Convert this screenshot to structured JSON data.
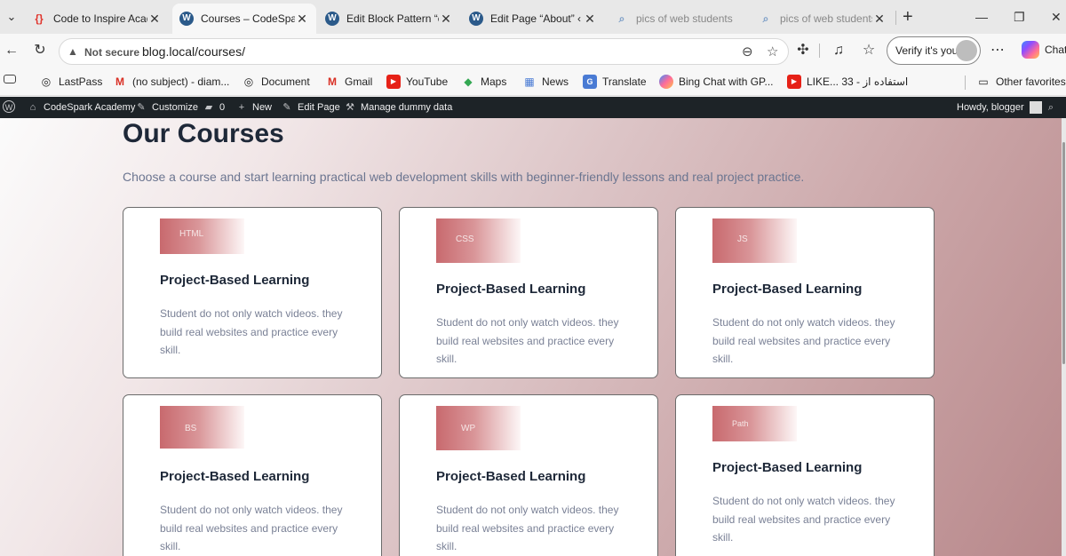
{
  "browser": {
    "tabs": [
      {
        "title": "Code to Inspire Acade",
        "icon": "code-bracket-icon"
      },
      {
        "title": "Courses – CodeSpark",
        "icon": "wordpress-icon"
      },
      {
        "title": "Edit Block Pattern “ca",
        "icon": "wordpress-icon"
      },
      {
        "title": "Edit Page “About” ‹ C",
        "icon": "wordpress-icon"
      },
      {
        "title": "pics of web students",
        "icon": "search-icon"
      },
      {
        "title": "pics of web students",
        "icon": "search-icon"
      }
    ],
    "address": {
      "security": "Not secure",
      "host": "blog.local",
      "path": "/courses/"
    },
    "verify_label": "Verify it's you",
    "chat_label": "Chat"
  },
  "bookmarks": {
    "items": [
      {
        "label": "LastPass"
      },
      {
        "label": "(no subject) - diam..."
      },
      {
        "label": "Document"
      },
      {
        "label": "Gmail"
      },
      {
        "label": "YouTube"
      },
      {
        "label": "Maps"
      },
      {
        "label": "News"
      },
      {
        "label": "Translate"
      },
      {
        "label": "Bing Chat with GP..."
      },
      {
        "label": "LIKE... استفاده از - 33"
      }
    ],
    "other": "Other favorites"
  },
  "adminbar": {
    "site": "CodeSpark Academy",
    "customize": "Customize",
    "comments": "0",
    "new": "New",
    "edit": "Edit Page",
    "dummy": "Manage dummy data",
    "howdy": "Howdy, blogger"
  },
  "page": {
    "title": "Our Courses",
    "intro": "Choose a course and start learning practical web development skills with beginner-friendly lessons and real project practice.",
    "cards": [
      {
        "tag": "HTML",
        "title": "Project-Based Learning",
        "desc": "Student do not only watch videos. they build real websites and practice every skill."
      },
      {
        "tag": "CSS",
        "title": "Project-Based Learning",
        "desc": "Student do not only watch videos. they build real websites and practice every skill."
      },
      {
        "tag": "JS",
        "title": "Project-Based Learning",
        "desc": "Student do not only watch videos. they build real websites and practice every skill."
      },
      {
        "tag": "BS",
        "title": "Project-Based Learning",
        "desc": "Student do not only watch videos. they build real websites and practice every skill."
      },
      {
        "tag": "WP",
        "title": "Project-Based Learning",
        "desc": "Student do not only watch videos. they build real websites and practice every skill."
      },
      {
        "tag": "Path",
        "title": "Project-Based Learning",
        "desc": "Student do not only watch videos. they build real websites and practice every skill."
      }
    ]
  }
}
